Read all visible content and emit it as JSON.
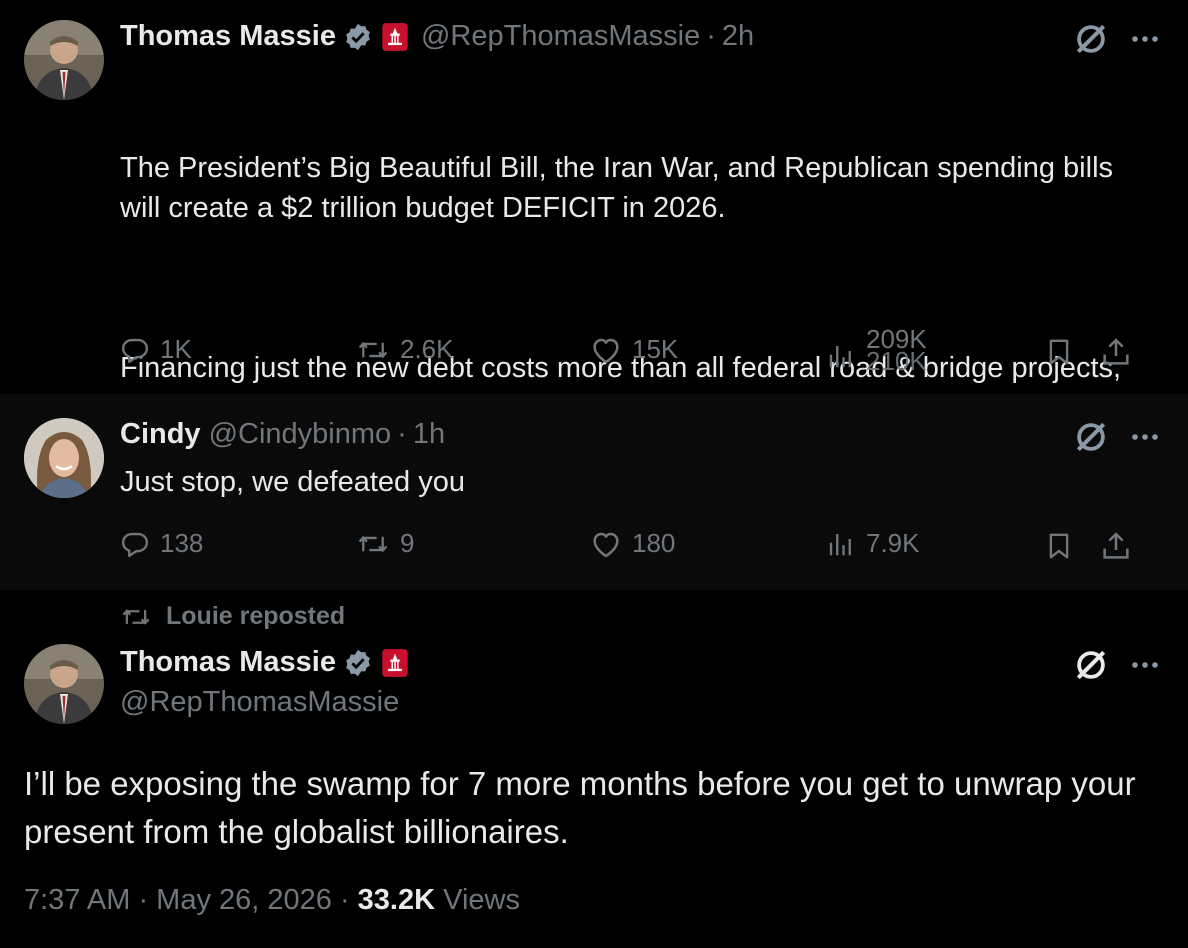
{
  "tweets": [
    {
      "display_name": "Thomas Massie",
      "handle": "@RepThomasMassie",
      "time": "2h",
      "paragraphs": [
        "The President’s Big Beautiful Bill, the Iran War, and Republican spending bills will create a $2 trillion budget DEFICIT in 2026.",
        "Financing just the new debt costs more than all federal road & bridge projects, and we will be making those new interest payments each year, forever."
      ],
      "replies": "1K",
      "reposts": "2.6K",
      "likes": "15K",
      "views_top": "209K",
      "views_bottom": "210K"
    },
    {
      "display_name": "Cindy",
      "handle": "@Cindybinmo",
      "time": "1h",
      "text": "Just stop, we defeated you",
      "replies": "138",
      "reposts": "9",
      "likes": "180",
      "views": "7.9K"
    },
    {
      "repost_label": "Louie reposted",
      "display_name": "Thomas Massie",
      "handle": "@RepThomasMassie",
      "text": "I’ll be exposing the swamp for 7 more months before you get to unwrap your present from the globalist billionaires.",
      "timestamp": "7:37 AM · May 26, 2026 · ",
      "views_count": "33.2K",
      "views_label": " Views"
    }
  ],
  "colors": {
    "background": "#000000",
    "highlight_background": "#0a0a0a",
    "text_primary": "#e7e9ea",
    "text_secondary": "#71767b",
    "verified_blue": "#8b98a5",
    "badge_red": "#c8102e"
  },
  "icons": [
    "verified-badge-icon",
    "house-gop-badge-icon",
    "grok-icon",
    "more-icon",
    "reply-icon",
    "repost-icon",
    "like-icon",
    "views-icon",
    "bookmark-icon",
    "share-icon"
  ]
}
